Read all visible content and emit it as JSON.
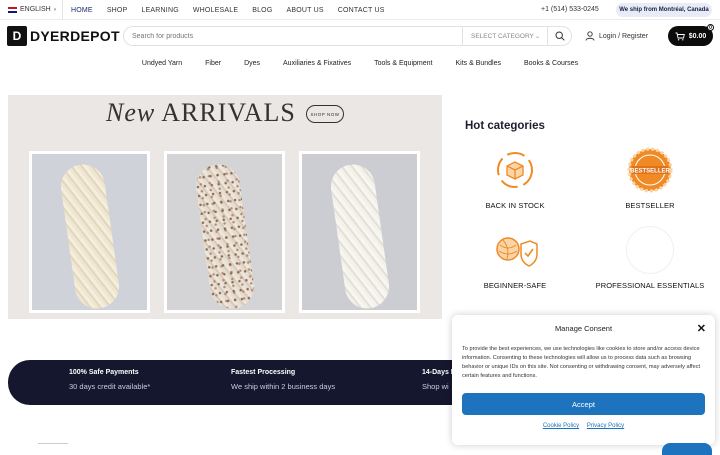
{
  "topbar": {
    "language": "ENGLISH",
    "nav": [
      "HOME",
      "SHOP",
      "LEARNING",
      "WHOLESALE",
      "BLOG",
      "ABOUT US",
      "CONTACT US"
    ],
    "phone": "+1 (514) 533-0245",
    "ship_badge": "We ship from Montréal, Canada"
  },
  "header": {
    "logo_mark": "D",
    "logo_text": "DYERDEPOT",
    "search_placeholder": "Search for products",
    "category_select": "SELECT CATEGORY",
    "login": "Login / Register",
    "cart_total": "$0.00",
    "cart_count": "0"
  },
  "categories": [
    "Undyed Yarn",
    "Fiber",
    "Dyes",
    "Auxiliaries & Fixatives",
    "Tools & Equipment",
    "Kits & Bundles",
    "Books & Courses"
  ],
  "hero": {
    "title_script": "New",
    "title_main": "ARRIVALS",
    "button": "SHOP NOW"
  },
  "hot": {
    "title": "Hot categories",
    "items": [
      "BACK IN STOCK",
      "BESTSELLER",
      "BEGINNER-SAFE",
      "PROFESSIONAL ESSENTIALS"
    ]
  },
  "features": [
    {
      "title": "100% Safe Payments",
      "sub": "30 days credit available*"
    },
    {
      "title": "Fastest Processing",
      "sub": "We ship within 2 business days"
    },
    {
      "title": "14-Days R",
      "sub": "Shop wi"
    }
  ],
  "consent": {
    "title": "Manage Consent",
    "body": "To provide the best experiences, we use technologies like cookies to store and/or access device information. Consenting to these technologies will allow us to process data such as browsing behavior or unique IDs on this site. Not consenting or withdrawing consent, may adversely affect certain features and functions.",
    "accept": "Accept",
    "cookie_policy": "Cookie Policy",
    "privacy_policy": "Privacy Policy"
  },
  "colors": {
    "accent_blue": "#1e73be",
    "navy": "#14172e",
    "active_nav": "#1a2a6c",
    "orange_icon": "#f08a24"
  }
}
